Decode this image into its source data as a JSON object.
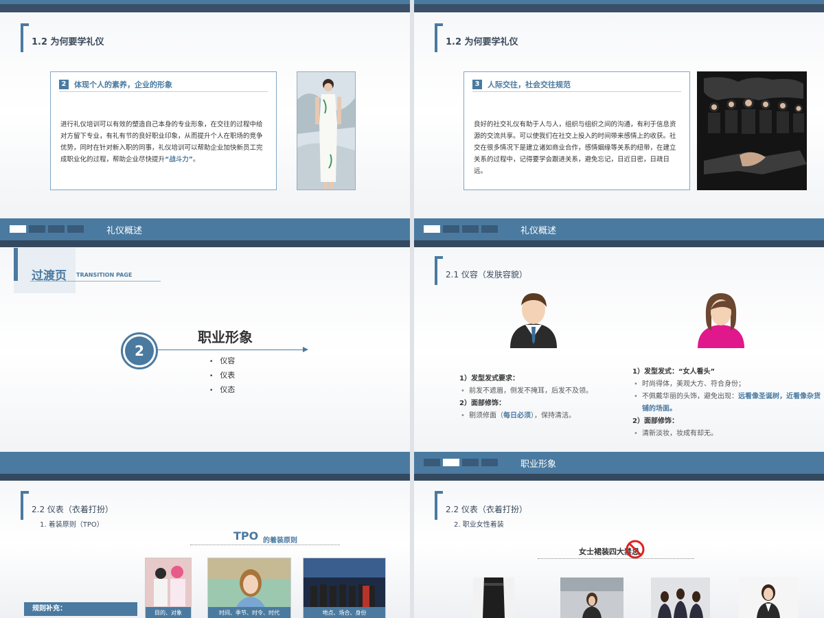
{
  "slide1": {
    "section_title": "1.2 为何要学礼仪",
    "box": {
      "number": "2",
      "heading": "体现个人的素养，企业的形象",
      "body": "进行礼仪培训可以有效的塑造自己本身的专业形象，在交往的过程中给对方留下专业，有礼有节的良好职业印象，从而提升个人在职场的竞争优势，同时在针对新入职的同事，礼仪培训可以帮助企业加快新员工完成职业化的过程，帮助企业尽快提升",
      "highlight": "“战斗力”",
      "end": "。"
    },
    "footer_label": "礼仪概述"
  },
  "slide2": {
    "section_title": "1.2 为何要学礼仪",
    "box": {
      "number": "3",
      "heading": "人际交往，社会交往规范",
      "body": "良好的社交礼仪有助于人与人，组织与组织之间的沟通，有利于信息资源的交流共享。可以使我们在社交上投入的时间带来感情上的收获。社交在很多情况下是建立诸如商业合作，感情姻缘等关系的纽带，在建立关系的过程中，记得要学会跟进关系，避免忘记，日近日密，日疏日远。"
    },
    "footer_label": "礼仪概述"
  },
  "slide3": {
    "transition_title": "过渡页",
    "transition_sub": "TRANSITION PAGE",
    "number": "2",
    "title": "职业形象",
    "items": [
      "仪容",
      "仪表",
      "仪态"
    ]
  },
  "slide4": {
    "section_title": "2.1 仪容（发肤容貌）",
    "male": {
      "h1": "1）发型发式要求：",
      "s1": "前发不遮眉，侧发不掩耳，后发不及领。",
      "h2": "2）面部修饰：",
      "s2a": "剔须修面（",
      "s2b": "每日必须",
      "s2c": "），保持清洁。"
    },
    "female": {
      "h1": "1）发型发式：“女人看头”",
      "s1": "时尚得体，美观大方、符合身份；",
      "s2a": "不佩戴华丽的头饰，避免出现：",
      "s2b": "远看像圣诞树，近看像杂货铺的场面。",
      "h2": "2）面部修饰：",
      "s3": "清新淡妆，妆成有却无。"
    },
    "footer_label": "职业形象",
    "colors": {
      "male_accent": "#3a6f9a",
      "female_accent": "#e0188c"
    }
  },
  "slide5": {
    "section_title": "2.2 仪表（衣着打扮）",
    "sub_title": "1. 着装原则（TPO）",
    "tpo": "TPO",
    "tpo_suffix": "的着装原则",
    "rule_label": "规则补充：",
    "cards": [
      "目的、对象",
      "时间、季节、时令、时代",
      "地点、场合、身份"
    ]
  },
  "slide6": {
    "section_title": "2.2 仪表（衣着打扮）",
    "sub_title": "2. 职业女性着装",
    "heading": "女士裙装四大禁忌"
  }
}
